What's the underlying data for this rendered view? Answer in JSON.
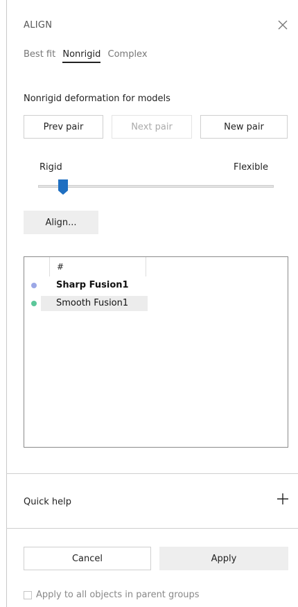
{
  "panel": {
    "title": "ALIGN",
    "close_icon": "close-icon"
  },
  "tabs": [
    {
      "label": "Best fit",
      "active": false
    },
    {
      "label": "Nonrigid",
      "active": true
    },
    {
      "label": "Complex",
      "active": false
    }
  ],
  "section": {
    "title": "Nonrigid deformation for models"
  },
  "pair_buttons": {
    "prev": "Prev pair",
    "next": "Next pair",
    "new": "New pair"
  },
  "slider": {
    "left_label": "Rigid",
    "right_label": "Flexible",
    "value_fraction": 0.1
  },
  "align_button": "Align...",
  "list": {
    "header": "#",
    "items": [
      {
        "label": "Sharp Fusion1",
        "color": "#9ba7e6",
        "selected": true
      },
      {
        "label": "Smooth Fusion1",
        "color": "#5cc79a",
        "selected": false
      }
    ]
  },
  "quick_help": {
    "label": "Quick help",
    "expand_icon": "plus-icon"
  },
  "footer": {
    "cancel": "Cancel",
    "apply": "Apply",
    "checkbox_label": "Apply to all objects in parent groups",
    "checkbox_checked": false
  },
  "colors": {
    "accent": "#1f6fc1",
    "apply_bg": "#eeeeee"
  }
}
